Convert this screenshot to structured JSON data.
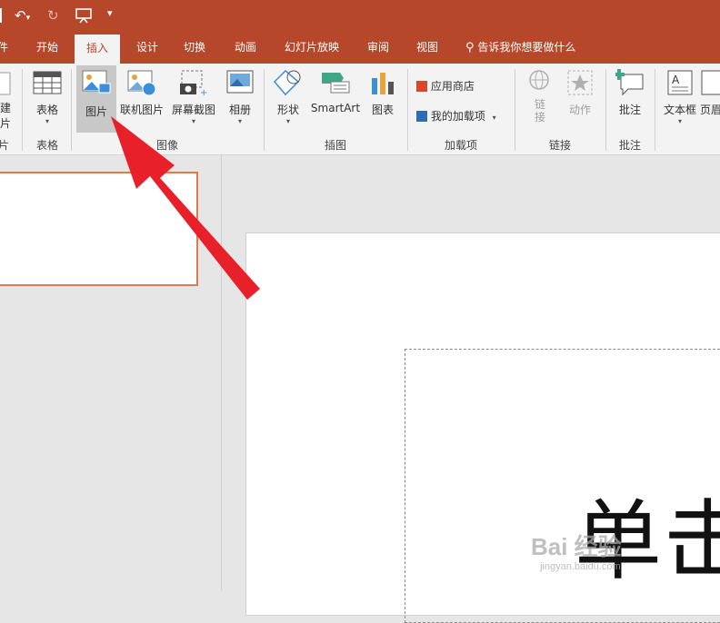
{
  "tabs": [
    "件",
    "开始",
    "插入",
    "设计",
    "切换",
    "动画",
    "幻灯片放映",
    "审阅",
    "视图"
  ],
  "tell_me": "告诉我你想要做什么",
  "ribbon": {
    "left_partial": {
      "line1": "建",
      "line2": "片",
      "group": "片"
    },
    "tables": {
      "button": "表格",
      "group": "表格"
    },
    "images": {
      "picture": "图片",
      "online_pictures": "联机图片",
      "screenshot": "屏幕截图",
      "album": "相册",
      "group": "图像"
    },
    "illustrations": {
      "shapes": "形状",
      "smartart": "SmartArt",
      "chart": "图表",
      "group": "插图"
    },
    "addins": {
      "store": "应用商店",
      "my_addins": "我的加载项",
      "group": "加载项"
    },
    "links": {
      "link_top": "链",
      "link_bottom": "接",
      "action": "动作",
      "group": "链接"
    },
    "comments": {
      "comment": "批注",
      "group": "批注"
    },
    "text": {
      "textbox": "文本框",
      "header_partial": "页眉"
    }
  },
  "slide": {
    "overlay_text": "单击"
  },
  "watermark": {
    "main": "Bai 经验",
    "sub": "jingyan.baidu.com"
  },
  "colors": {
    "accent": "#b7472a",
    "arrow": "#e8202a",
    "selected_thumb_border": "#e07a4f"
  }
}
